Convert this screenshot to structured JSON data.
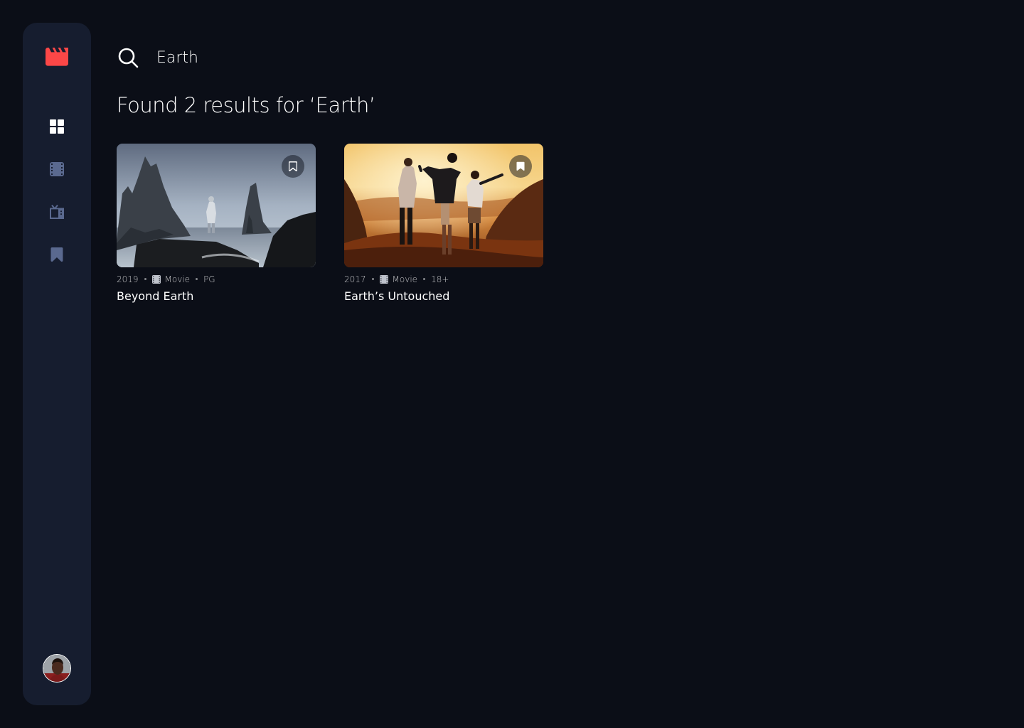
{
  "colors": {
    "background": "#0b0e17",
    "sidebar": "#161d2f",
    "accent": "#fc4747",
    "nav_active": "#ffffff",
    "nav_inactive": "#5a698f"
  },
  "sidebar": {
    "logo_icon": "movie-clapper-icon",
    "items": [
      {
        "name": "home",
        "icon": "grid-icon",
        "active": true
      },
      {
        "name": "movies",
        "icon": "film-icon",
        "active": false
      },
      {
        "name": "tv-series",
        "icon": "tv-icon",
        "active": false
      },
      {
        "name": "bookmarked",
        "icon": "bookmark-icon",
        "active": false
      }
    ],
    "avatar_icon": "user-avatar"
  },
  "search": {
    "value": "Earth",
    "icon": "search-icon"
  },
  "results": {
    "title": "Found 2 results for ‘Earth’",
    "items": [
      {
        "year": "2019",
        "category": "Movie",
        "category_icon": "film-icon",
        "rating": "PG",
        "title": "Beyond Earth",
        "bookmarked": false
      },
      {
        "year": "2017",
        "category": "Movie",
        "category_icon": "film-icon",
        "rating": "18+",
        "title": "Earth’s Untouched",
        "bookmarked": true
      }
    ]
  }
}
